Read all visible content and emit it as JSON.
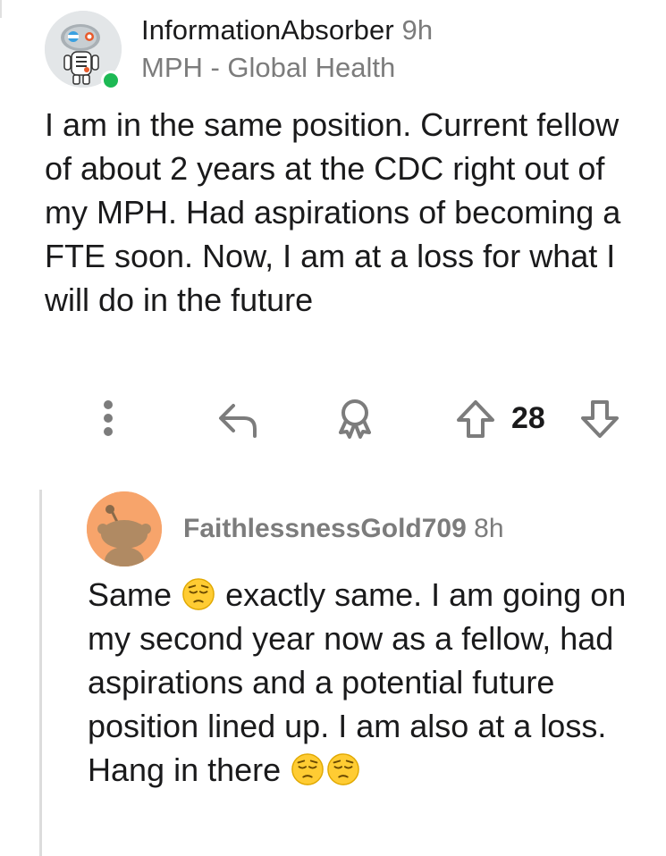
{
  "comment": {
    "author": "InformationAbsorber",
    "time": "9h",
    "flair": "MPH - Global Health",
    "body": "I am in the same position. Current fellow of about 2 years at the CDC right out of my MPH. Had aspirations of becoming a FTE soon. Now, I am at a loss for what I will do in the future",
    "score": "28",
    "icons": {
      "more": "more-vertical-icon",
      "reply": "reply-icon",
      "award": "award-icon",
      "upvote": "upvote-arrow-icon",
      "downvote": "downvote-arrow-icon"
    }
  },
  "reply": {
    "author": "FaithlessnessGold709",
    "time": "8h",
    "body_parts": [
      "Same",
      "exactly same. I am going on my second year now as a fellow, had aspirations and a potential future position lined up. I am also at a loss. Hang in there"
    ],
    "emoji": "pensive-face-emoji"
  },
  "colors": {
    "text": "#1a1a1b",
    "muted": "#7c7c7c",
    "online": "#1db954",
    "reply_avatar_bg": "#f7a46b",
    "icon_stroke": "#7c7c7c"
  }
}
